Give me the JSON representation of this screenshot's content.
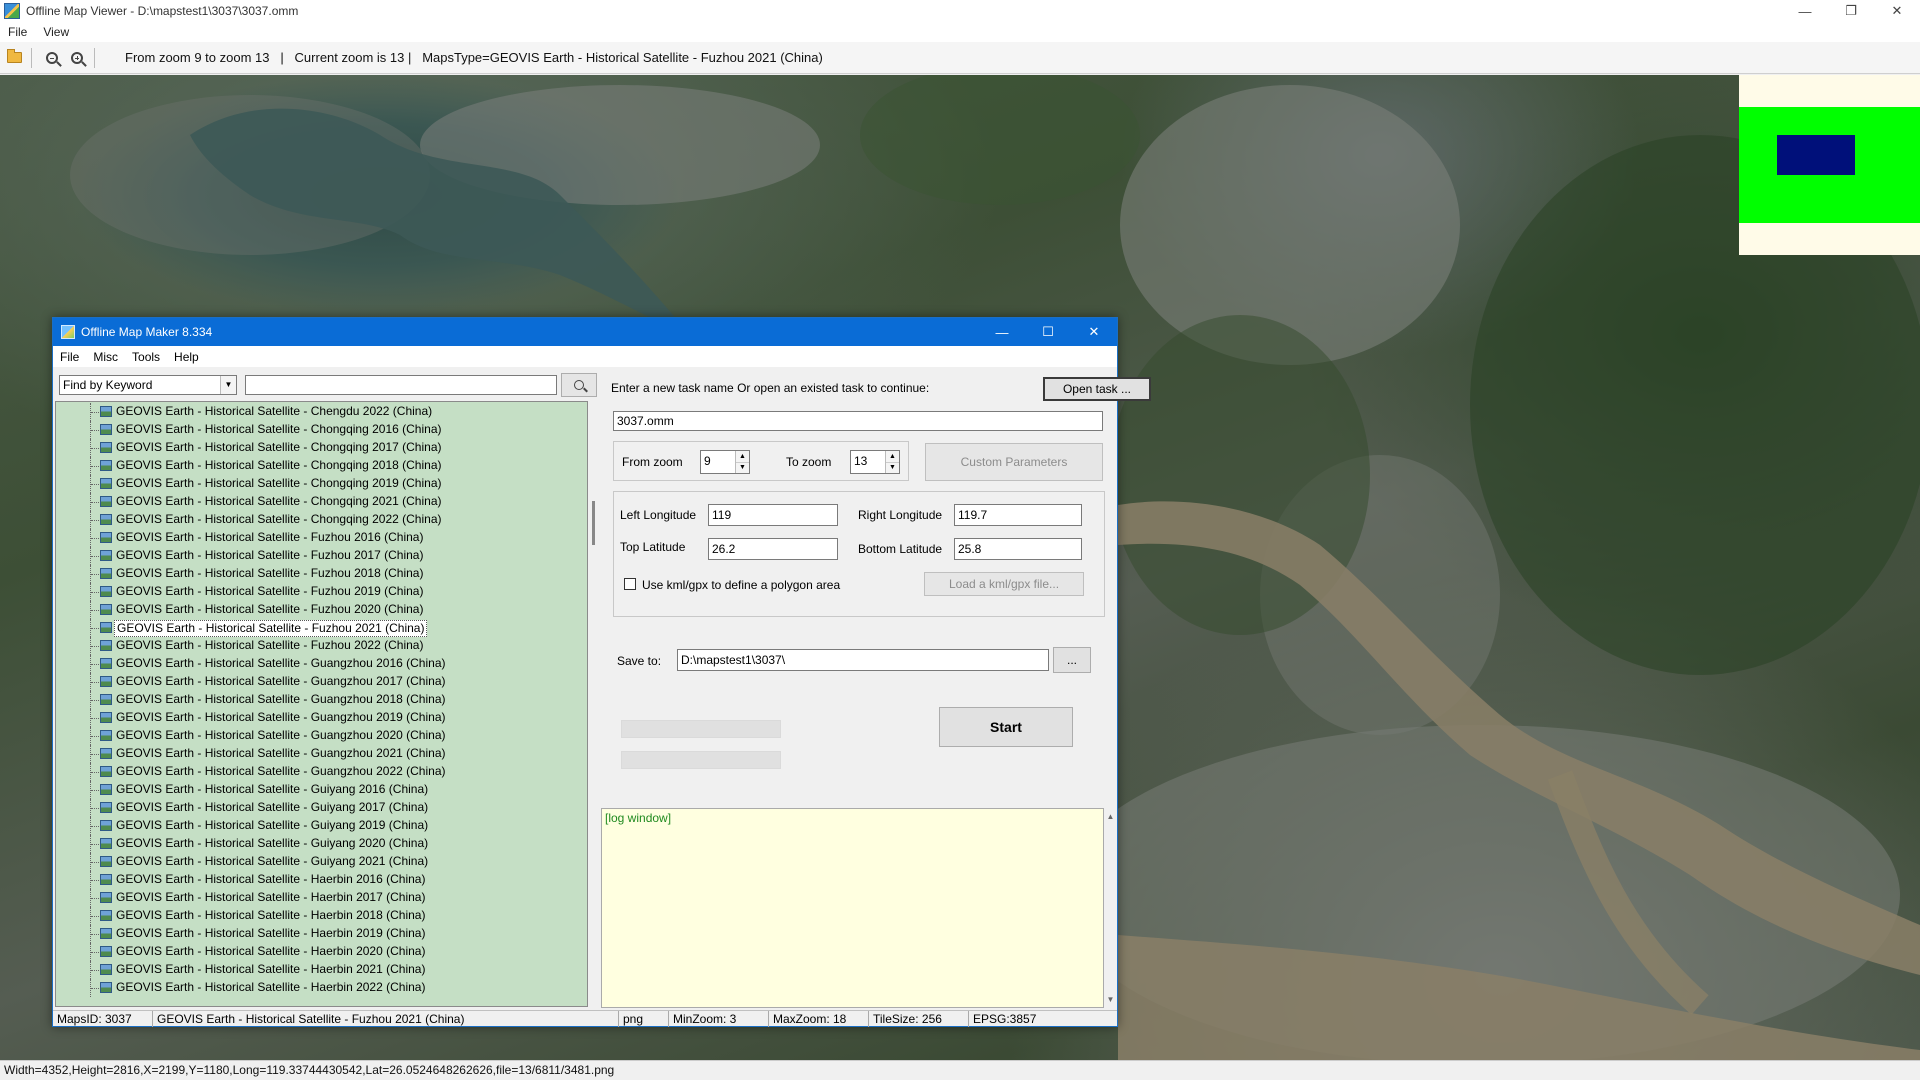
{
  "viewer": {
    "title": "Offline Map Viewer - D:\\mapstest1\\3037\\3037.omm",
    "controls": {
      "minimize": "—",
      "restore": "❐",
      "close": "✕"
    },
    "menu": [
      "File",
      "View"
    ],
    "toolbar_info": "From zoom 9 to zoom 13   |   Current zoom is 13 |   MapsType=GEOVIS Earth - Historical Satellite - Fuzhou 2021 (China)",
    "status": "Width=4352,Height=2816,X=2199,Y=1180,Long=119.33744430542,Lat=26.0524648262626,file=13/6811/3481.png",
    "colors": {
      "overview_bg": "#fffbe8",
      "overview_green": "#00ff00",
      "overview_rect": "#00107a"
    }
  },
  "dialog": {
    "title": "Offline Map Maker 8.334",
    "controls": {
      "minimize": "—",
      "maximize": "☐",
      "close": "✕"
    },
    "menu": [
      "File",
      "Misc",
      "Tools",
      "Help"
    ],
    "find_mode": "Find by Keyword",
    "search_value": "",
    "tree_items": [
      "GEOVIS Earth - Historical Satellite - Chengdu 2022 (China)",
      "GEOVIS Earth - Historical Satellite - Chongqing 2016 (China)",
      "GEOVIS Earth - Historical Satellite - Chongqing 2017 (China)",
      "GEOVIS Earth - Historical Satellite - Chongqing 2018 (China)",
      "GEOVIS Earth - Historical Satellite - Chongqing 2019 (China)",
      "GEOVIS Earth - Historical Satellite - Chongqing 2021 (China)",
      "GEOVIS Earth - Historical Satellite - Chongqing 2022 (China)",
      "GEOVIS Earth - Historical Satellite - Fuzhou 2016 (China)",
      "GEOVIS Earth - Historical Satellite - Fuzhou 2017 (China)",
      "GEOVIS Earth - Historical Satellite - Fuzhou 2018 (China)",
      "GEOVIS Earth - Historical Satellite - Fuzhou 2019 (China)",
      "GEOVIS Earth - Historical Satellite - Fuzhou 2020 (China)",
      "GEOVIS Earth - Historical Satellite - Fuzhou 2021 (China)",
      "GEOVIS Earth - Historical Satellite - Fuzhou 2022 (China)",
      "GEOVIS Earth - Historical Satellite - Guangzhou 2016 (China)",
      "GEOVIS Earth - Historical Satellite - Guangzhou 2017 (China)",
      "GEOVIS Earth - Historical Satellite - Guangzhou 2018 (China)",
      "GEOVIS Earth - Historical Satellite - Guangzhou 2019 (China)",
      "GEOVIS Earth - Historical Satellite - Guangzhou 2020 (China)",
      "GEOVIS Earth - Historical Satellite - Guangzhou 2021 (China)",
      "GEOVIS Earth - Historical Satellite - Guangzhou 2022 (China)",
      "GEOVIS Earth - Historical Satellite - Guiyang 2016 (China)",
      "GEOVIS Earth - Historical Satellite - Guiyang 2017 (China)",
      "GEOVIS Earth - Historical Satellite - Guiyang 2019 (China)",
      "GEOVIS Earth - Historical Satellite - Guiyang 2020 (China)",
      "GEOVIS Earth - Historical Satellite - Guiyang 2021 (China)",
      "GEOVIS Earth - Historical Satellite - Haerbin 2016 (China)",
      "GEOVIS Earth - Historical Satellite - Haerbin 2017 (China)",
      "GEOVIS Earth - Historical Satellite - Haerbin 2018 (China)",
      "GEOVIS Earth - Historical Satellite - Haerbin 2019 (China)",
      "GEOVIS Earth - Historical Satellite - Haerbin 2020 (China)",
      "GEOVIS Earth - Historical Satellite - Haerbin 2021 (China)",
      "GEOVIS Earth - Historical Satellite - Haerbin 2022 (China)"
    ],
    "selected_item": "GEOVIS Earth - Historical Satellite - Fuzhou 2021 (China)",
    "task_prompt": "Enter a new task name Or open an existed task to continue:",
    "open_task_label": "Open task ...",
    "task_name": "3037.omm",
    "from_zoom_label": "From zoom",
    "from_zoom": "9",
    "to_zoom_label": "To zoom",
    "to_zoom": "13",
    "custom_params_label": "Custom Parameters",
    "left_lon_label": "Left Longitude",
    "left_lon": "119",
    "right_lon_label": "Right Longitude",
    "right_lon": "119.7",
    "top_lat_label": "Top Latitude",
    "top_lat": "26.2",
    "bottom_lat_label": "Bottom Latitude",
    "bottom_lat": "25.8",
    "kml_checkbox_label": "Use kml/gpx to define a polygon area",
    "load_kml_label": "Load a kml/gpx file...",
    "save_to_label": "Save to:",
    "save_to": "D:\\mapstest1\\3037\\",
    "browse_label": "...",
    "start_label": "Start",
    "log_text": "[log window]",
    "status": {
      "maps_id": "MapsID: 3037",
      "map_name": "GEOVIS Earth - Historical Satellite - Fuzhou 2021 (China)",
      "format": "png",
      "min_zoom": "MinZoom: 3",
      "max_zoom": "MaxZoom: 18",
      "tile_size": "TileSize: 256",
      "epsg": "EPSG:3857"
    }
  }
}
